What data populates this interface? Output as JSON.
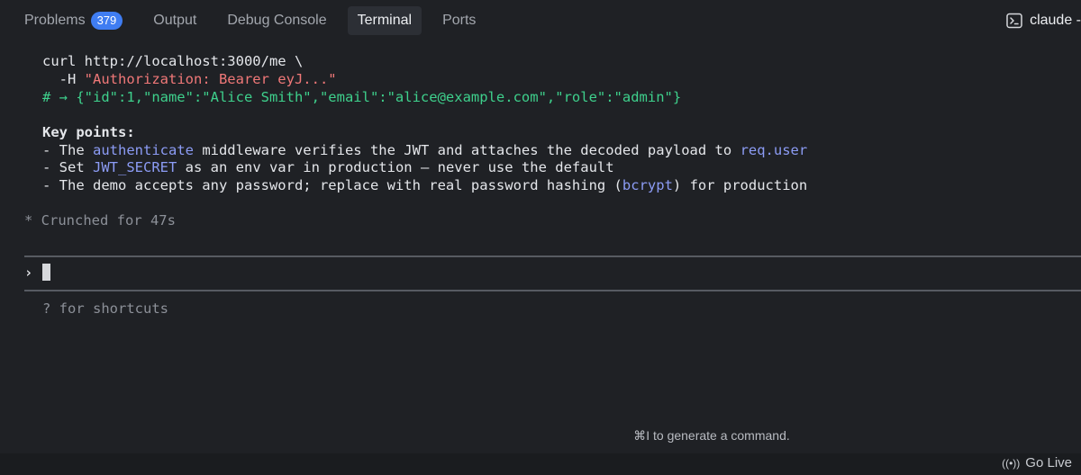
{
  "tabs": [
    {
      "label": "Problems",
      "badge": "379"
    },
    {
      "label": "Output"
    },
    {
      "label": "Debug Console"
    },
    {
      "label": "Terminal",
      "active": true
    },
    {
      "label": "Ports"
    }
  ],
  "session": {
    "label": "claude -",
    "icon": "terminal-icon"
  },
  "terminal": {
    "curl_line": "curl http://localhost:3000/me \\",
    "header_flag": "  -H ",
    "header_value": "\"Authorization: Bearer eyJ...\"",
    "response_line": "# → {\"id\":1,\"name\":\"Alice Smith\",\"email\":\"alice@example.com\",\"role\":\"admin\"}",
    "key_points_title": "Key points:",
    "point1": {
      "prefix": "- The ",
      "term1": "authenticate",
      "middle": " middleware verifies the JWT and attaches the decoded payload to ",
      "term2": "req.user"
    },
    "point2": {
      "prefix": "- Set ",
      "term": "JWT_SECRET",
      "suffix": " as an env var in production — never use the default"
    },
    "point3": {
      "prefix": "- The demo accepts any password; replace with real password hashing (",
      "term": "bcrypt",
      "suffix": ") for production"
    },
    "status": "* Crunched for 47s",
    "prompt_symbol": "›",
    "shortcuts_hint": "? for shortcuts"
  },
  "command_hint": "⌘I to generate a command.",
  "statusbar": {
    "go_live": "Go Live",
    "go_live_icon": "broadcast-icon"
  },
  "colors": {
    "background": "#1f2125",
    "badge": "#3f7df2",
    "string": "#f07878",
    "comment": "#3ed08c",
    "highlight": "#8c9cf5"
  }
}
